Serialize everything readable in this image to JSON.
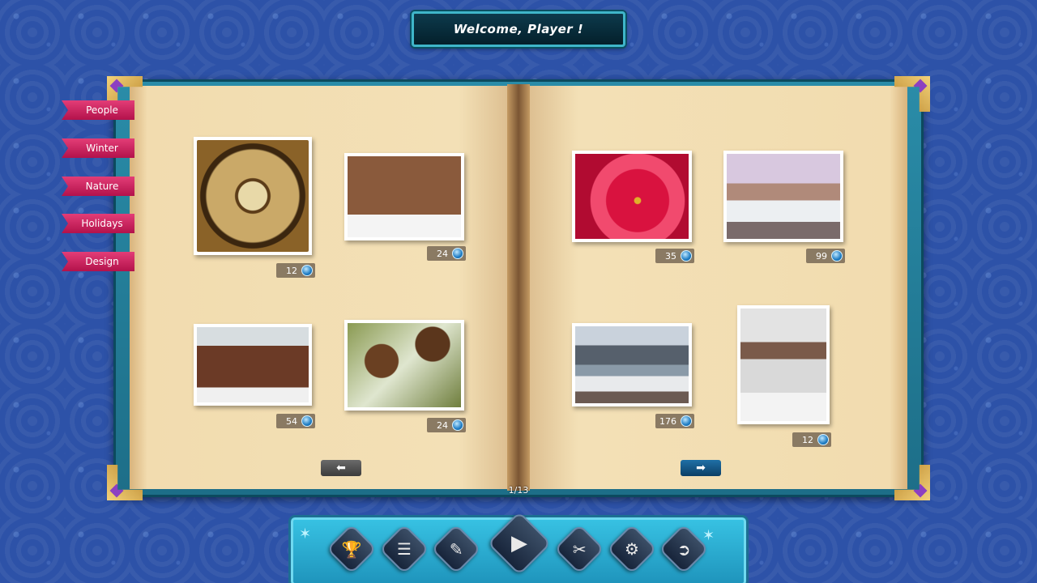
{
  "welcome": {
    "text": "Welcome, Player !"
  },
  "categories": [
    {
      "label": "People"
    },
    {
      "label": "Winter"
    },
    {
      "label": "Nature"
    },
    {
      "label": "Holidays"
    },
    {
      "label": "Design"
    }
  ],
  "puzzles": [
    {
      "subject": "antique clock",
      "count": "12"
    },
    {
      "subject": "lantern and snowman",
      "count": "24"
    },
    {
      "subject": "snowy wooden temple",
      "count": "54"
    },
    {
      "subject": "pine cones",
      "count": "24"
    },
    {
      "subject": "red poinsettia",
      "count": "35"
    },
    {
      "subject": "snowy old town",
      "count": "99"
    },
    {
      "subject": "winter lake village",
      "count": "176"
    },
    {
      "subject": "castle tower in snow",
      "count": "12"
    }
  ],
  "pagination": {
    "current": "1/13",
    "prev_icon": "arrow-left-icon",
    "next_icon": "arrow-right-icon"
  },
  "toolbar": {
    "buttons": [
      {
        "icon": "trophy-icon"
      },
      {
        "icon": "menu-list-icon"
      },
      {
        "icon": "edit-image-icon"
      },
      {
        "icon": "play-icon"
      },
      {
        "icon": "scissors-icon"
      },
      {
        "icon": "gear-icon"
      },
      {
        "icon": "exit-door-icon"
      }
    ]
  },
  "colors": {
    "background": "#2d52a8",
    "ribbon": "#d22660",
    "frame": "#2a8ca8",
    "page": "#f2dcaf"
  }
}
